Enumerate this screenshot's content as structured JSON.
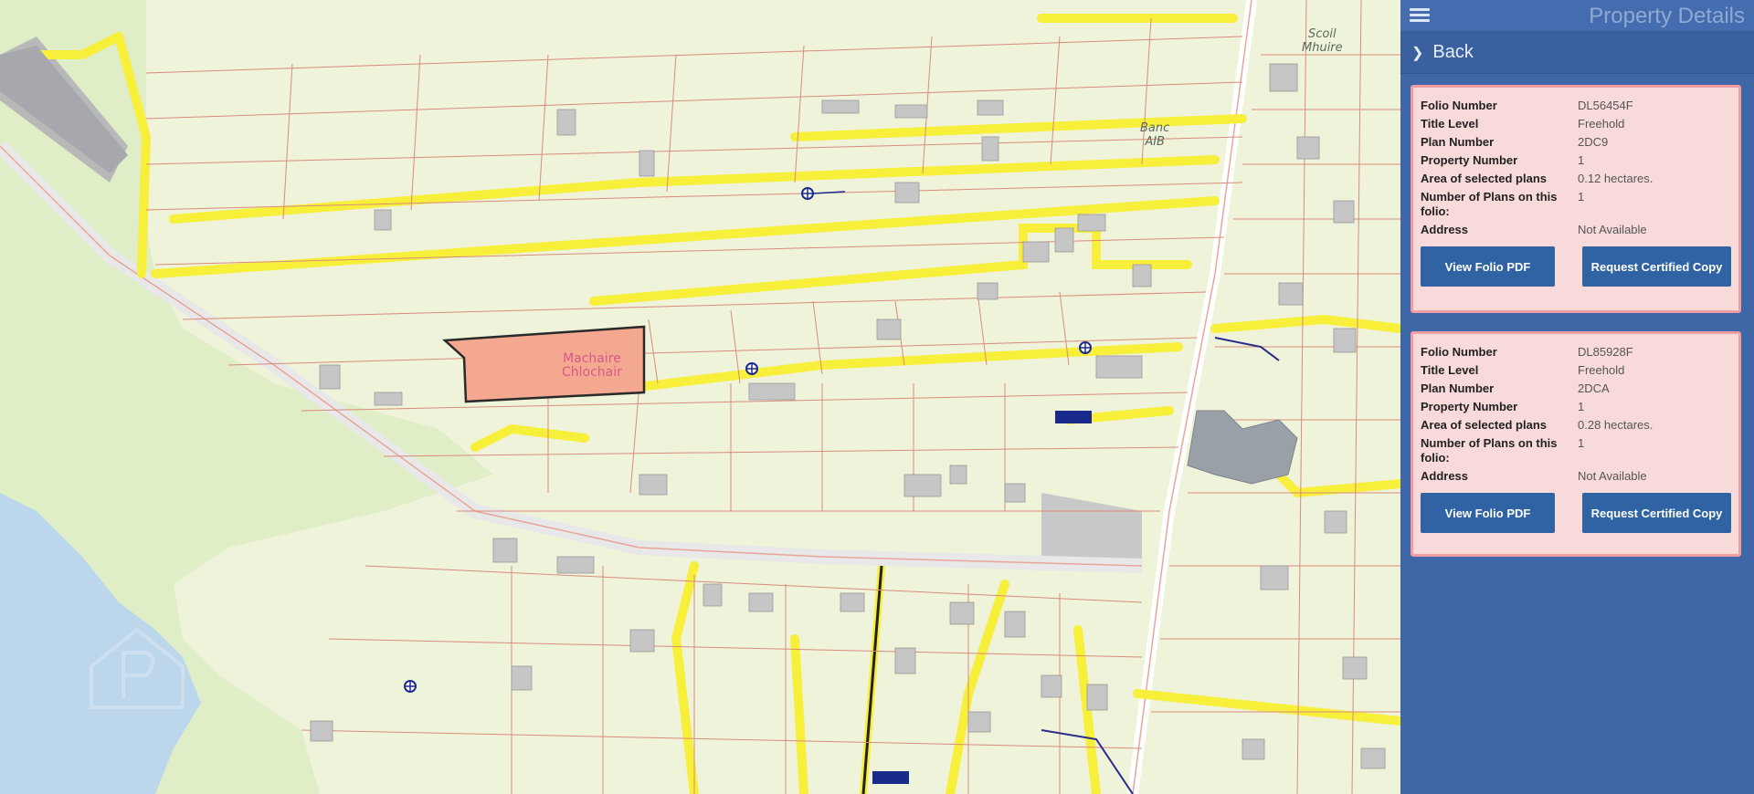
{
  "panel": {
    "title": "Property Details",
    "back_label": "Back",
    "menu_icon": "hamburger-menu-icon"
  },
  "folios": [
    {
      "rows": [
        {
          "label": "Folio Number",
          "value": "DL56454F"
        },
        {
          "label": "Title Level",
          "value": "Freehold"
        },
        {
          "label": "Plan Number",
          "value": "2DC9"
        },
        {
          "label": "Property Number",
          "value": "1"
        },
        {
          "label": "Area of selected plans",
          "value": "0.12 hectares."
        },
        {
          "label": "Number of Plans on this folio:",
          "value": "1"
        },
        {
          "label": "Address",
          "value": "Not Available"
        }
      ],
      "view_pdf_label": "View Folio PDF",
      "certified_copy_label": "Request Certified Copy"
    },
    {
      "rows": [
        {
          "label": "Folio Number",
          "value": "DL85928F"
        },
        {
          "label": "Title Level",
          "value": "Freehold"
        },
        {
          "label": "Plan Number",
          "value": "2DCA"
        },
        {
          "label": "Property Number",
          "value": "1"
        },
        {
          "label": "Area of selected plans",
          "value": "0.28 hectares."
        },
        {
          "label": "Number of Plans on this folio:",
          "value": "1"
        },
        {
          "label": "Address",
          "value": "Not Available"
        }
      ],
      "view_pdf_label": "View Folio PDF",
      "certified_copy_label": "Request Certified Copy"
    }
  ],
  "map": {
    "labels": {
      "school": "Scoil\nMhuire",
      "bank": "Banc\nAIB",
      "parcel": "Machaire\nChlochair"
    },
    "colors": {
      "land": "#dfeec7",
      "water": "#bcd6ec",
      "selected_parcel": "#f4a88f",
      "boundary": "#d98b7c",
      "highlight_road": "#f8ef3a",
      "marker": "#1a2a8c"
    },
    "watermark_icon": "property-logo-icon"
  }
}
